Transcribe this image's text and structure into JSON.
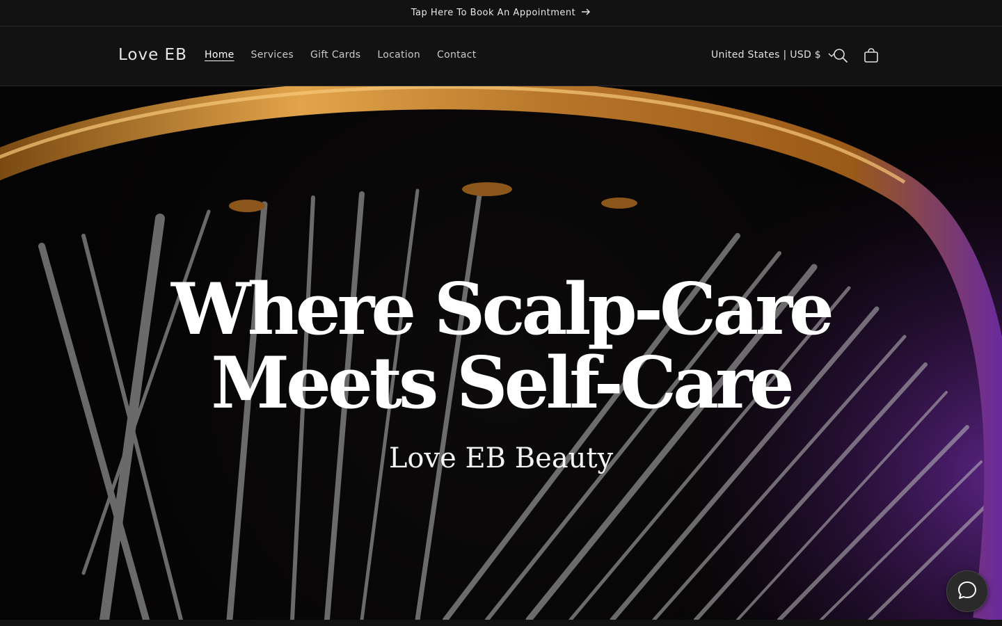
{
  "announcement": {
    "text": "Tap Here To Book An Appointment",
    "icon": "arrow-right-icon"
  },
  "header": {
    "logo": "Love EB",
    "nav": [
      {
        "label": "Home",
        "active": true
      },
      {
        "label": "Services",
        "active": false
      },
      {
        "label": "Gift Cards",
        "active": false
      },
      {
        "label": "Location",
        "active": false
      },
      {
        "label": "Contact",
        "active": false
      }
    ],
    "country_selector": "United States | USD $",
    "icons": [
      "chevron-down-icon",
      "search-icon",
      "cart-icon"
    ]
  },
  "hero": {
    "title_line1": "Where Scalp-Care",
    "title_line2": "Meets Self-Care",
    "subtitle": "Love EB Beauty"
  },
  "chat": {
    "icon": "chat-bubble-icon"
  },
  "colors": {
    "background": "#121212",
    "text": "#ffffff",
    "gold": "#c8892c",
    "purple": "#6a2a9c"
  }
}
